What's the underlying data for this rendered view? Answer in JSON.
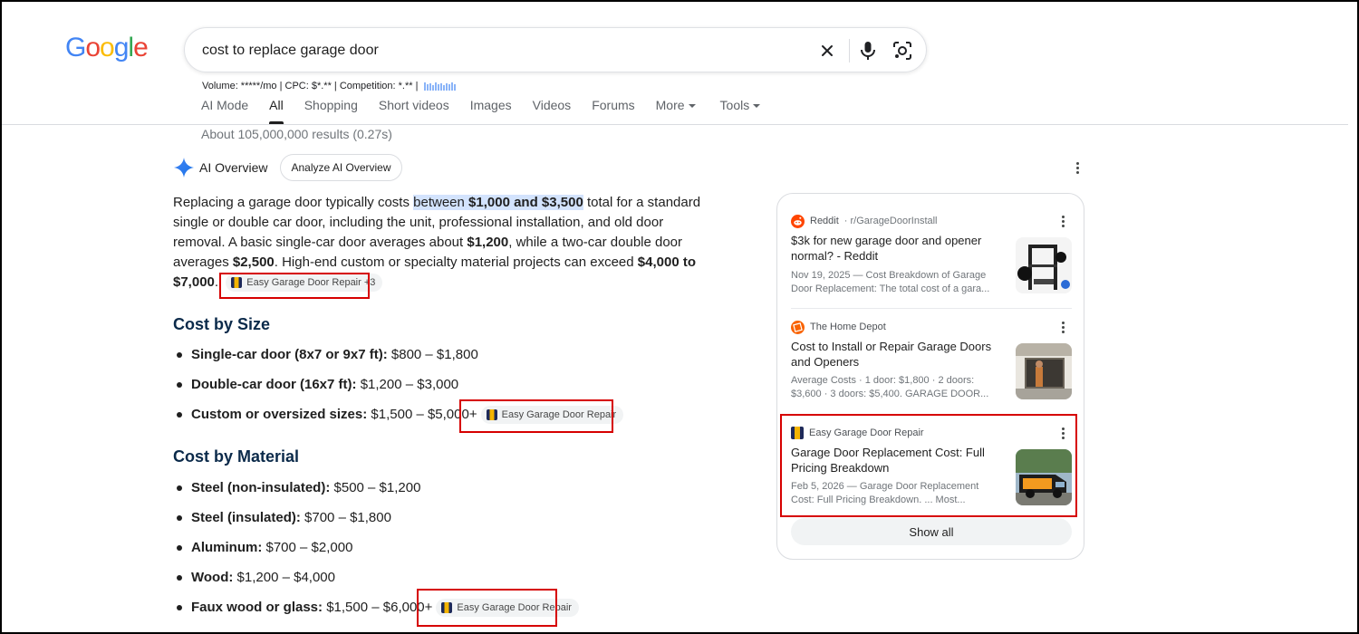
{
  "logo": "Google",
  "search": {
    "query": "cost to replace garage door"
  },
  "seo": {
    "text": "Volume: *****/mo | CPC: $*.** | Competition: *.** |"
  },
  "tabs": [
    {
      "label": "AI Mode",
      "active": false
    },
    {
      "label": "All",
      "active": true
    },
    {
      "label": "Shopping",
      "active": false
    },
    {
      "label": "Short videos",
      "active": false
    },
    {
      "label": "Images",
      "active": false
    },
    {
      "label": "Videos",
      "active": false
    },
    {
      "label": "Forums",
      "active": false
    },
    {
      "label": "More",
      "active": false
    },
    {
      "label": "Tools",
      "active": false
    }
  ],
  "results_count": "About 105,000,000 results (0.27s)",
  "ai_overview": {
    "title": "AI Overview",
    "analyze_label": "Analyze AI Overview",
    "p1": "Replacing a garage door typically costs ",
    "p1_hl_a": "between ",
    "p1_hl_b": "$1,000 and $3,500",
    "p2": " total for a standard single or double car door, including the unit, professional installation, and old door removal. A basic single-car door averages about ",
    "p2_b": "$1,200",
    "p3": ", while a two-car double door averages ",
    "p3_b": "$2,500",
    "p4": ". High-end custom or specialty material projects can exceed ",
    "p4_b": "$4,000 to $7,000",
    "p4_end": ".",
    "chip1": "Easy Garage Door Repair +3"
  },
  "cost_by_size": {
    "heading": "Cost by Size",
    "items": [
      {
        "label": "Single-car door (8x7 or 9x7 ft):",
        "value": " $800 – $1,800"
      },
      {
        "label": "Double-car door (16x7 ft):",
        "value": " $1,200 – $3,000"
      },
      {
        "label": "Custom or oversized sizes:",
        "value": " $1,500 – $5,000+",
        "chip": "Easy Garage Door Repair"
      }
    ]
  },
  "cost_by_material": {
    "heading": "Cost by Material",
    "items": [
      {
        "label": "Steel (non-insulated):",
        "value": " $500 – $1,200"
      },
      {
        "label": "Steel (insulated):",
        "value": " $700 – $1,800"
      },
      {
        "label": "Aluminum:",
        "value": " $700 – $2,000"
      },
      {
        "label": "Wood:",
        "value": " $1,200 – $4,000"
      },
      {
        "label": "Faux wood or glass:",
        "value": " $1,500 – $6,000+",
        "chip": "Easy Garage Door Repair"
      }
    ]
  },
  "sources": [
    {
      "site": "Reddit",
      "sub": "· r/GarageDoorInstall",
      "title": "$3k for new garage door and opener normal? - Reddit",
      "snippet": "Nov 19, 2025 — Cost Breakdown of Garage Door Replacement: The total cost of a gara..."
    },
    {
      "site": "The Home Depot",
      "sub": "",
      "title": "Cost to Install or Repair Garage Doors and Openers",
      "snippet": "Average Costs · 1 door: $1,800 · 2 doors: $3,600 · 3 doors: $5,400. GARAGE DOOR..."
    },
    {
      "site": "Easy Garage Door Repair",
      "sub": "",
      "title": "Garage Door Replacement Cost: Full Pricing Breakdown",
      "snippet": "Feb 5, 2026 — Garage Door Replacement Cost: Full Pricing Breakdown. ... Most..."
    }
  ],
  "show_all": "Show all",
  "colors": {
    "accent_red": "#d60000",
    "highlight": "#d3e3fd",
    "heading_navy": "#0b2a4a"
  }
}
